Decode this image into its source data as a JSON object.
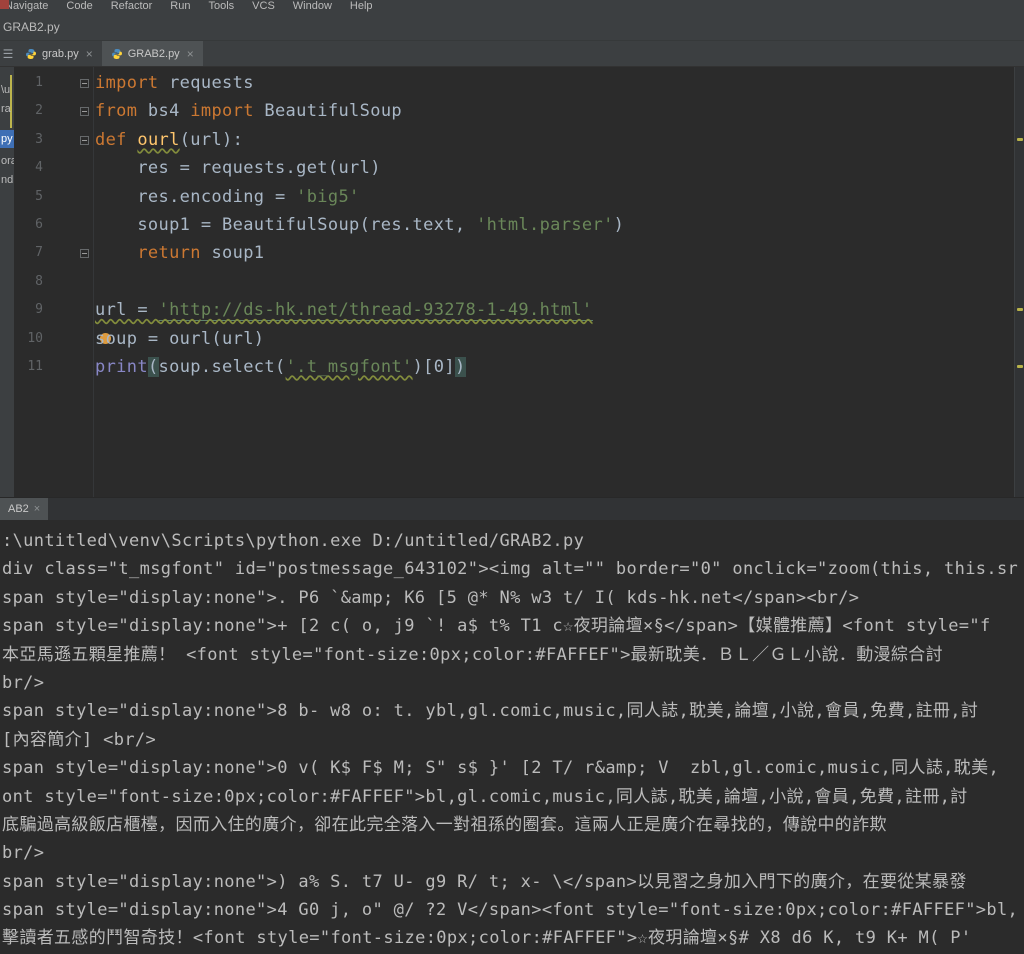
{
  "menu": {
    "items": [
      "Navigate",
      "Code",
      "Refactor",
      "Run",
      "Tools",
      "VCS",
      "Window",
      "Help"
    ]
  },
  "navbar": {
    "file": "GRAB2.py"
  },
  "tabs": [
    {
      "label": "grab.py"
    },
    {
      "label": "GRAB2.py",
      "selected": true
    }
  ],
  "tab_close_glyph": "×",
  "project": {
    "fragments": [
      {
        "t": "\\u"
      },
      {
        "t": "ra"
      },
      {
        "t": "py",
        "selected": true
      },
      {
        "t": "ora"
      },
      {
        "t": "nd"
      }
    ]
  },
  "editor": {
    "lines": [
      {
        "num": "1",
        "fold": "open",
        "seg": [
          {
            "t": "import",
            "c": "kw"
          },
          {
            "t": " requests",
            "c": "p"
          }
        ]
      },
      {
        "num": "2",
        "fold": "end",
        "seg": [
          {
            "t": "from",
            "c": "kw"
          },
          {
            "t": " bs4 ",
            "c": "p"
          },
          {
            "t": "import",
            "c": "kw"
          },
          {
            "t": " BeautifulSoup",
            "c": "p"
          }
        ]
      },
      {
        "num": "3",
        "fold": "open",
        "seg": [
          {
            "t": "def",
            "c": "kw"
          },
          {
            "t": " ",
            "c": "p"
          },
          {
            "t": "ourl",
            "c": "fn typo"
          },
          {
            "t": "(url):",
            "c": "p"
          }
        ]
      },
      {
        "num": "4",
        "seg": [
          {
            "t": "    res = requests.get(url)",
            "c": "p"
          }
        ]
      },
      {
        "num": "5",
        "seg": [
          {
            "t": "    res.encoding = ",
            "c": "p"
          },
          {
            "t": "'big5'",
            "c": "s"
          }
        ]
      },
      {
        "num": "6",
        "seg": [
          {
            "t": "    soup1 = BeautifulSoup(res.text, ",
            "c": "p"
          },
          {
            "t": "'html.parser'",
            "c": "s"
          },
          {
            "t": ")",
            "c": "p"
          }
        ]
      },
      {
        "num": "7",
        "fold": "end",
        "seg": [
          {
            "t": "    ",
            "c": "p"
          },
          {
            "t": "return",
            "c": "kw"
          },
          {
            "t": " soup1",
            "c": "p"
          }
        ]
      },
      {
        "num": "8",
        "seg": []
      },
      {
        "num": "9",
        "seg": [
          {
            "t": "url = ",
            "c": "p typo"
          },
          {
            "t": "'http://ds-hk.net/thread-93278-1-49.html'",
            "c": "s link typo"
          }
        ]
      },
      {
        "num": "10",
        "seg": [
          {
            "t": "soup = ourl(url)",
            "c": "p"
          }
        ]
      },
      {
        "num": "11",
        "seg": [
          {
            "t": "print",
            "c": "b"
          },
          {
            "t": "(",
            "c": "p match"
          },
          {
            "t": "soup.select(",
            "c": "p"
          },
          {
            "t": "'.t_msgfont'",
            "c": "s typo"
          },
          {
            "t": ")[0]",
            "c": "p"
          },
          {
            "t": ")",
            "c": "p match"
          }
        ]
      }
    ]
  },
  "console": {
    "tab": "AB2",
    "lines": [
      ":\\untitled\\venv\\Scripts\\python.exe D:/untitled/GRAB2.py",
      "div class=\"t_msgfont\" id=\"postmessage_643102\"><img alt=\"\" border=\"0\" onclick=\"zoom(this, this.sr",
      "span style=\"display:none\">. P6 `&amp; K6 [5 @* N% w3 t/ I( kds-hk.net</span><br/>",
      "span style=\"display:none\">+ [2 c( o, j9 `! a$ t% T1 c☆夜玥論壇×§</span>【媒體推薦】<font style=\"f",
      "本亞馬遜五顆星推薦！ <font style=\"font-size:0px;color:#FAFFEF\">最新耽美．ＢＬ／ＧＬ小說．動漫綜合討",
      "br/>",
      "span style=\"display:none\">8 b- w8 o: t. ybl,gl.comic,music,同人誌,耽美,論壇,小說,會員,免費,註冊,討",
      "[內容簡介] <br/>",
      "span style=\"display:none\">0 v( K$ F$ M; S\" s$ }' [2 T/ r&amp; V  zbl,gl.comic,music,同人誌,耽美,",
      "ont style=\"font-size:0px;color:#FAFFEF\">bl,gl.comic,music,同人誌,耽美,論壇,小說,會員,免費,註冊,討",
      "底騙過高級飯店櫃檯，因而入住的廣介，卻在此完全落入一對祖孫的圈套。這兩人正是廣介在尋找的，傳說中的詐欺",
      "br/>",
      "span style=\"display:none\">) a% S. t7 U- g9 R/ t; x- \\</span>以見習之身加入門下的廣介，在要從某暴發",
      "span style=\"display:none\">4 G0 j, o\" @/ ?2 V</span><font style=\"font-size:0px;color:#FAFFEF\">bl,",
      "擊讀者五感的鬥智奇技！<font style=\"font-size:0px;color:#FAFFEF\">☆夜玥論壇×§# X8 d6 K, t9 K+ M( P'"
    ]
  },
  "colors": {
    "editor_bg": "#2B2B2B",
    "chrome_bg": "#3C3F41",
    "keyword": "#CC7832",
    "string": "#6A8759",
    "function_name": "#FFC66D",
    "builtin": "#8887C6",
    "text": "#A9B7C6",
    "line_number": "#606366",
    "console_text": "#BBBBBB",
    "selection_blue": "#3E6FB5",
    "caret_mark": "#DE9B3E"
  }
}
